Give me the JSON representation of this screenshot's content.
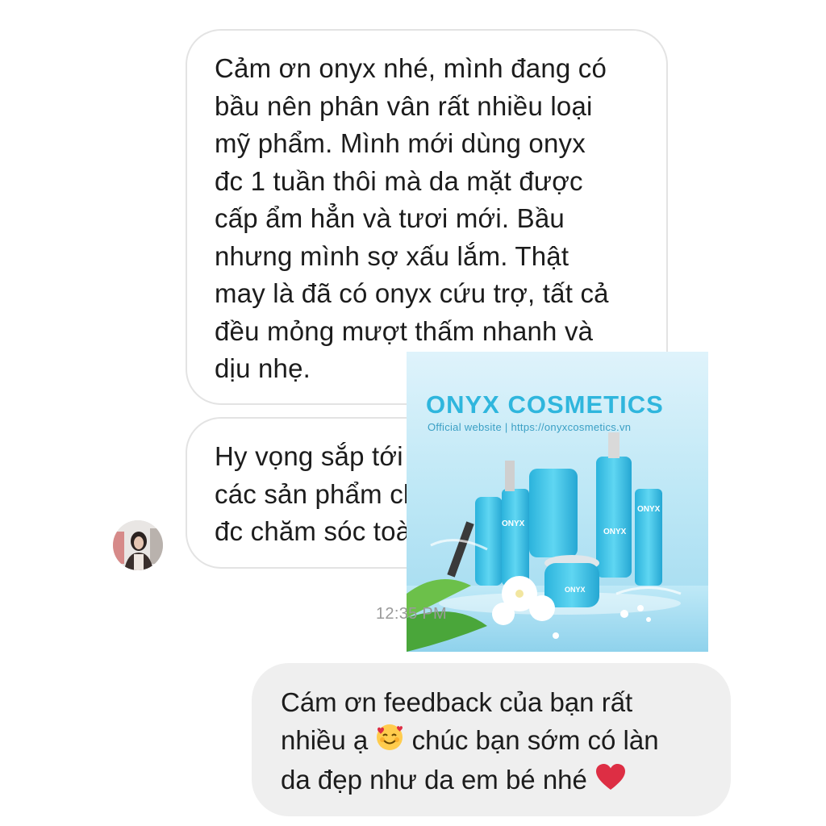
{
  "conversation": {
    "incoming_1": {
      "lines": [
        "Cảm ơn onyx nhé, mình đang có",
        "bầu nên phân vân rất nhiều loại",
        "mỹ phẩm. Mình mới dùng onyx",
        "đc 1 tuần thôi mà da mặt được",
        "cấp ẩm hẳn và tươi mới. Bầu",
        "nhưng mình sợ xấu lắm. Thật",
        "may là đã có onyx cứu trợ, tất cả",
        "đều mỏng mượt thấm nhanh và",
        "dịu nhẹ."
      ]
    },
    "incoming_2": {
      "lines": [
        "Hy vọng sắp tới onyx sẽ có thêm",
        "các sản phẩm cho body để bầu",
        "đc chăm sóc toàn diện hơn ạ"
      ]
    },
    "timestamp": "12:35 PM",
    "outgoing": {
      "line1": "Cám ơn feedback của bạn rất",
      "line2_a": "nhiều ạ",
      "line2_b": "chúc bạn sớm có làn",
      "line3_a": "da đẹp như da em bé nhé",
      "emoji_1": "smiling-face-with-hearts-icon",
      "emoji_2": "red-heart-icon"
    }
  },
  "ad_overlay": {
    "brand": "ONYX COSMETICS",
    "subtitle": "Official website |  https://onyxcosmetics.vn",
    "product_brand": "ONYX"
  },
  "colors": {
    "incoming_bubble_border": "#e3e3e3",
    "outgoing_bubble_bg": "#efefef",
    "brand_blue": "#2fb6dd",
    "product_cyan": "#35c3e6"
  }
}
